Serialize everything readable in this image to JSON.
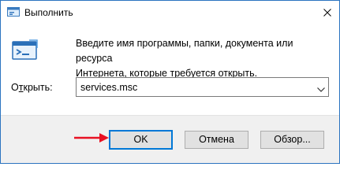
{
  "window": {
    "title": "Выполнить",
    "close_symbol": "✕"
  },
  "icons": {
    "app": "run-dialog-icon",
    "main": "run-program-icon",
    "close": "close-icon",
    "dropdown": "chevron-down-icon",
    "annotation": "red-arrow-annotation"
  },
  "body": {
    "description": "Введите имя программы, папки, документа или ресурса\nИнтернета, которые требуется открыть.",
    "open_label_prefix": "О",
    "open_label_underlined": "т",
    "open_label_suffix": "крыть:"
  },
  "combo": {
    "value": "services.msc"
  },
  "buttons": {
    "ok": "OK",
    "cancel": "Отмена",
    "browse": "Обзор..."
  },
  "colors": {
    "accent": "#0078d7",
    "border": "#2b74c0",
    "arrow": "#e81123"
  }
}
